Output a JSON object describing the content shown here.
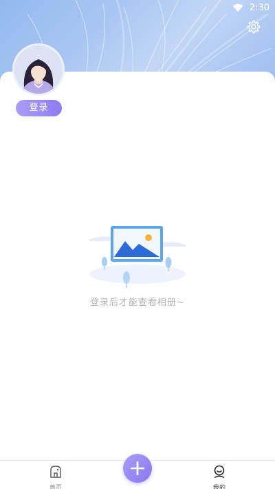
{
  "status_bar": {
    "time": "2:30",
    "wifi_icon": "wifi-icon"
  },
  "header": {
    "settings_icon": "gear-icon"
  },
  "profile": {
    "avatar_icon": "avatar",
    "login_label": "登录"
  },
  "empty_state": {
    "illustration": "photo-icon",
    "message": "登录后才能查看相册~"
  },
  "bottom_nav": {
    "items": [
      {
        "label": "首页",
        "icon": "home-icon"
      },
      {
        "label": "我的",
        "icon": "user-icon"
      }
    ],
    "add_icon": "plus-icon"
  },
  "colors": {
    "accent": "#8c7cf2",
    "header_blue": "#a9c6f2",
    "muted_text": "#b4b4b4"
  }
}
